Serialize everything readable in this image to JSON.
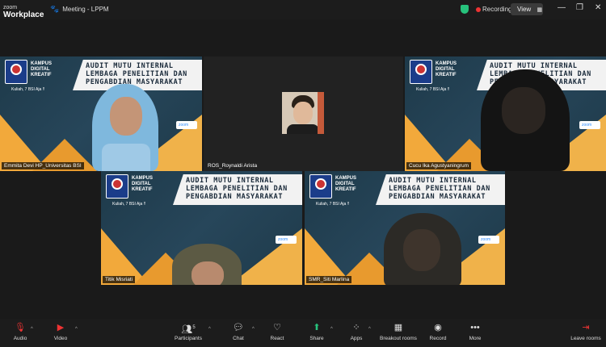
{
  "app": {
    "brand_line1": "zoom",
    "brand_line2": "Workplace",
    "meeting_title": "Meeting - LPPM",
    "recording": "Recording",
    "view": "View"
  },
  "slide": {
    "kampus": "KAMPUS DIGITAL KREATIF",
    "kuliah": "Kuliah, 7 BSI Aja !!",
    "line1": "AUDIT MUTU INTERNAL",
    "line2": "LEMBAGA PENELITIAN DAN",
    "line3": "PENGABDIAN MASYARAKAT",
    "zoom": "zoom"
  },
  "participants": [
    {
      "name": "Emmita Devi HP_Universitas BSI"
    },
    {
      "name": "ROS_Roynaldi Arista"
    },
    {
      "name": "Cucu Ika Agustyaningrum"
    },
    {
      "name": "Titik Misriati"
    },
    {
      "name": "SMR_Siti Marlina"
    }
  ],
  "toolbar": {
    "audio": "Audio",
    "video": "Video",
    "participants": "Participants",
    "participants_count": "5",
    "chat": "Chat",
    "react": "React",
    "share": "Share",
    "apps": "Apps",
    "breakout": "Breakout rooms",
    "record": "Record",
    "more": "More",
    "leave": "Leave rooms"
  },
  "colors": {
    "active_speaker": "#26d07c",
    "recording": "#e33333",
    "slide_orange": "#f2a93b",
    "slide_navy": "#1e3a4a"
  }
}
